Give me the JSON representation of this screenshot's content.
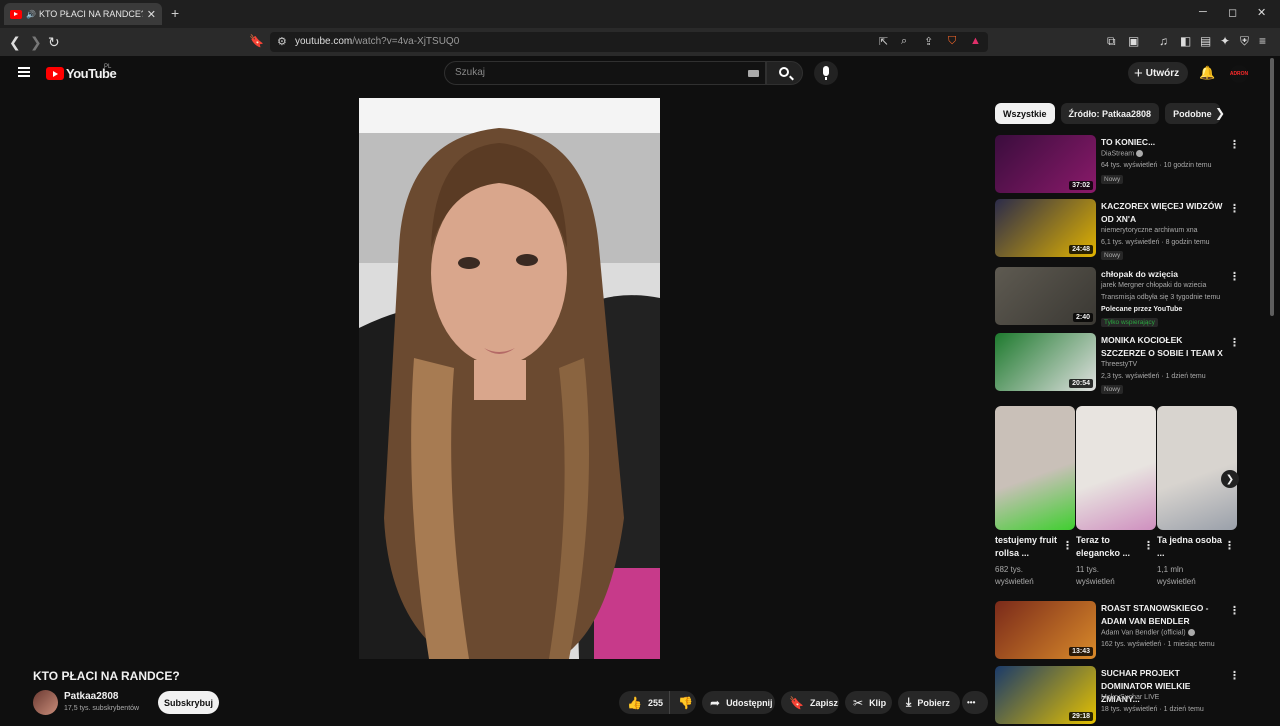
{
  "browser": {
    "tab_title": "KTO PŁACI NA RANDCE? - YouTube",
    "tab_close": "✕",
    "new_tab": "+",
    "url_host": "youtube.com",
    "url_path": "/watch?v=4va-XjTSUQ0",
    "win_min": "─",
    "win_max": "◻",
    "win_close": "✕"
  },
  "header": {
    "logo_text": "YouTube",
    "country_code": "PL",
    "search_placeholder": "Szukaj",
    "create_label": "Utwórz",
    "account_label": "ADRON"
  },
  "video": {
    "title": "KTO PŁACI NA RANDCE?",
    "channel_name": "Patkaa2808",
    "channel_subs": "17,5 tys. subskrybentów",
    "subscribe_label": "Subskrybuj",
    "likes": "255",
    "share_label": "Udostępnij",
    "save_label": "Zapisz",
    "clip_label": "Klip",
    "download_label": "Pobierz",
    "more_label": "•••"
  },
  "sidebar": {
    "chips": [
      {
        "label": "Wszystkie"
      },
      {
        "label": "Źródło: Patkaa2808"
      },
      {
        "label": "Podobne"
      }
    ],
    "recommendations": [
      {
        "title": "TO KONIEC...",
        "channel": "DiaStream",
        "verified": true,
        "meta": "64 tys. wyświetleń · 10 godzin temu",
        "badge": "Nowy",
        "duration": "37:02",
        "colors": [
          "#3a0d3d",
          "#8a1a6a"
        ]
      },
      {
        "title": "KACZOREX WIĘCEJ WIDZÓW OD XN'A",
        "channel": "niemerytoryczne archiwum xna",
        "meta": "6,1 tys. wyświetleń · 8 godzin temu",
        "badge": "Nowy",
        "duration": "24:48",
        "colors": [
          "#2b2b4a",
          "#e1b300"
        ]
      },
      {
        "title": "chłopak do wzięcia",
        "channel": "jarek Mergner chłopaki do wziecia",
        "meta": "Transmisja odbyła się 3 tygodnie temu",
        "extra": "Polecane przez YouTube",
        "badge": "Tylko wspierający",
        "duration": "2:40",
        "colors": [
          "#5e5a51",
          "#3a3833"
        ]
      },
      {
        "title": "MONIKA KOCIOŁEK SZCZERZE O SOBIE I TEAM X",
        "channel": "ThreestyTV",
        "meta": "2,3 tys. wyświetleń · 1 dzień temu",
        "badge": "Nowy",
        "duration": "20:54",
        "colors": [
          "#1e7a2e",
          "#e0e0e0"
        ]
      },
      {
        "title": "ROAST STANOWSKIEGO - ADAM VAN BENDLER",
        "channel": "Adam Van Bendler (official)",
        "verified": true,
        "meta": "162 tys. wyświetleń · 1 miesiąc temu",
        "duration": "13:43",
        "colors": [
          "#7a2a1a",
          "#d98a2a"
        ]
      },
      {
        "title": "SUCHAR PROJEKT DOMINATOR WIELKIE ZMIANY...",
        "channel": "MokrySuchar LIVE",
        "meta": "18 tys. wyświetleń · 1 dzień temu",
        "duration": "29:18",
        "colors": [
          "#1a3a6a",
          "#e6c200"
        ]
      }
    ],
    "shorts": [
      {
        "title": "testujemy fruit rollsa ...",
        "views": "682 tys.",
        "views2": "wyświetleń",
        "colors": [
          "#c9c0b8",
          "#3fcf2f"
        ]
      },
      {
        "title": "Teraz to elegancko ...",
        "views": "11 tys.",
        "views2": "wyświetleń",
        "colors": [
          "#e8e4e0",
          "#cf8fbf"
        ]
      },
      {
        "title": "Ta jedna osoba ...",
        "views": "1,1 mln",
        "views2": "wyświetleń",
        "colors": [
          "#d8d4cf",
          "#9aa0aa"
        ]
      }
    ]
  }
}
